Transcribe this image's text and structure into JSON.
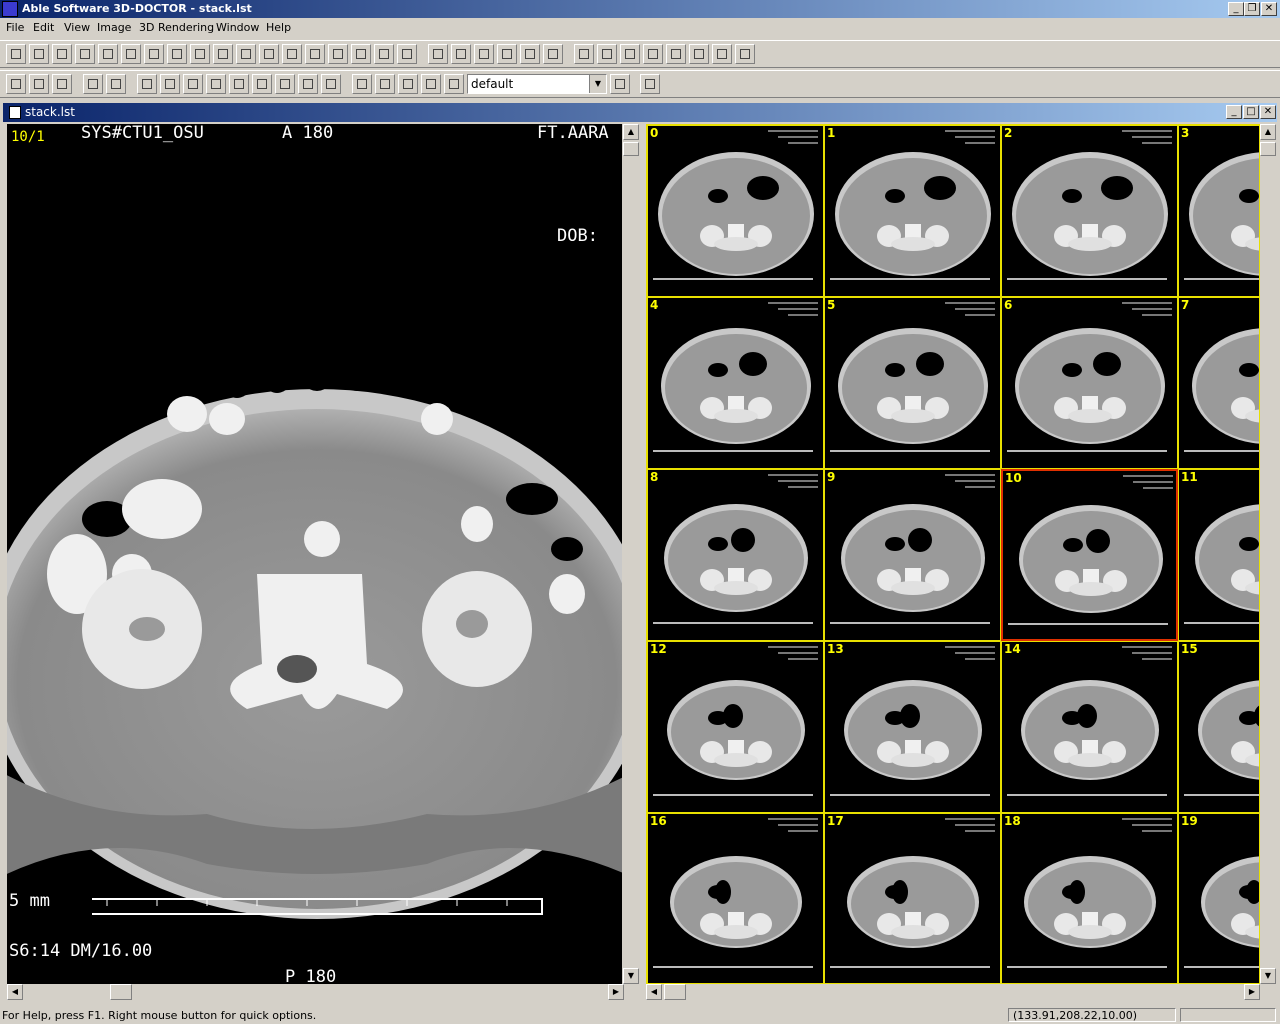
{
  "app": {
    "title": "Able Software 3D-DOCTOR - stack.lst"
  },
  "menu": [
    "File",
    "Edit",
    "View",
    "Image",
    "3D Rendering",
    "Window",
    "Help"
  ],
  "toolbar": {
    "palette_value": "default"
  },
  "document": {
    "title": "stack.lst"
  },
  "left_view": {
    "slice_label": "10/1",
    "overlay_top": "SYS#CTU1_OSU",
    "overlay_top2": "A 180",
    "overlay_top3": "FT.AARA",
    "overlay_dob": "DOB:",
    "overlay_bottom1": "5 mm",
    "overlay_bottom2": "S6:14 DM/16.00",
    "overlay_bottom3": "P 180"
  },
  "thumbnails": [
    "0",
    "1",
    "2",
    "3",
    "4",
    "5",
    "6",
    "7",
    "8",
    "9",
    "10",
    "11",
    "12",
    "13",
    "14",
    "15",
    "16",
    "17",
    "18",
    "19"
  ],
  "selected_thumbnail": "10",
  "status": {
    "help_text": "For Help, press F1. Right mouse button for quick options.",
    "coords": "(133.91,208.22,10.00)"
  },
  "colors": {
    "title_start": "#0a246a",
    "title_end": "#a6caf0",
    "grid": "#e8e000",
    "selection": "#e03000"
  }
}
